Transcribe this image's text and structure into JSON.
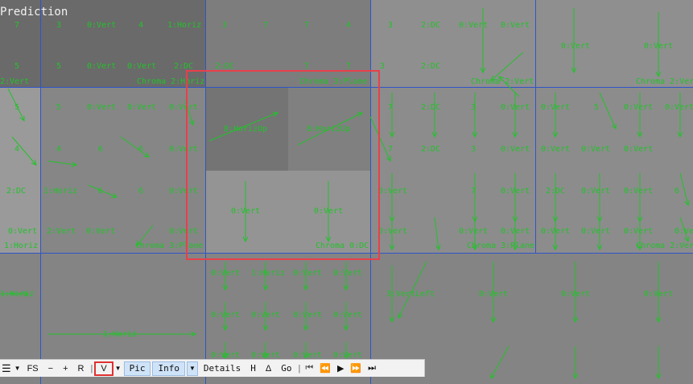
{
  "title": "Prediction",
  "labels": [
    "7",
    "3",
    "0:Vert",
    "4",
    "1:Horiz",
    "3",
    "7",
    "7",
    "4",
    "3",
    "2:DC",
    "0:Vert",
    "0:Vert",
    "5",
    "5",
    "0:Vert",
    "0:Vert",
    "2:DC",
    "2:DC",
    "7",
    "7",
    "3",
    "2:DC",
    "2:DC",
    "0:Vert",
    "0:Vert",
    "2:Vert",
    "Chroma 2:Horiz",
    "Chroma 3:Plane",
    "Chroma 2:Vert",
    "Chroma 2:Vert",
    "5",
    "5",
    "0:Vert",
    "0:Vert",
    "0:Vert",
    "8:HorizUp",
    "8:HorizUp",
    "7",
    "2:DC",
    "3",
    "0:Vert",
    "0:Vert",
    "5",
    "0:Vert",
    "0:Vert",
    "4",
    "4",
    "6",
    "6",
    "0:Vert",
    "7",
    "2:DC",
    "3",
    "0:Vert",
    "0:Vert",
    "0:Vert",
    "0:Vert",
    "2:DC",
    "1:Horiz",
    "6",
    "6",
    "0:Vert",
    "0:Vert",
    "0:Vert",
    "7",
    "0:Vert",
    "0:Vert",
    "2:DC",
    "0:Vert",
    "0:Vert",
    "6",
    "0:Vert",
    "0:Vert",
    "0:Vert",
    "0:Vert",
    "0:Vert",
    "0:Vert",
    "2:Vert",
    "0:Vert",
    "0:Vert",
    "0:Vert",
    "0:Vert",
    "1:Horiz",
    "Chroma 3:Plane",
    "Chroma 0:DC",
    "Chroma 3:Plane",
    "Chroma 2:Vert",
    "1:Horiz",
    "0:Vert",
    "1:Horiz",
    "0:Vert",
    "0:Vert",
    "3:VertLeft",
    "0:Vert",
    "0:Vert",
    "0:Vert",
    "0:Vert",
    "0:Vert",
    "0:Vert",
    "0:Vert",
    "1:Horiz",
    "0:Vert",
    "0:Vert",
    "0:Vert",
    "0:Vert"
  ],
  "toolbar": {
    "menu_icon": "hamburger-menu-icon",
    "fs": "FS",
    "minus": "−",
    "plus": "+",
    "r": "R",
    "sep": "|",
    "v": "V",
    "pic": "Pic",
    "info": "Info",
    "details": "Details",
    "h": "H",
    "delta": "Δ",
    "go": "Go",
    "dropdown_glyph": "▼",
    "first_glyph": "⏮",
    "prev_glyph": "⏪",
    "play_glyph": "▶",
    "next_glyph": "⏩",
    "last_glyph": "⏭"
  },
  "colors": {
    "grid": "#2f55c8",
    "label": "#22c22a",
    "highlight": "#e8404a",
    "toggle_bg": "#cfe3f8"
  }
}
